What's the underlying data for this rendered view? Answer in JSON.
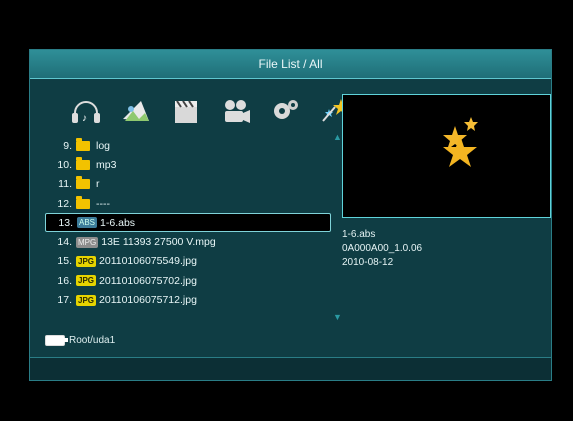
{
  "window": {
    "title": "File List / All"
  },
  "categories": [
    {
      "icon": "music-icon"
    },
    {
      "icon": "picture-icon"
    },
    {
      "icon": "movie-icon"
    },
    {
      "icon": "camera-icon"
    },
    {
      "icon": "gear-icon"
    },
    {
      "icon": "star-icon"
    }
  ],
  "files": [
    {
      "num": "9.",
      "badge": "folder",
      "name": "log"
    },
    {
      "num": "10.",
      "badge": "folder",
      "name": "mp3"
    },
    {
      "num": "11.",
      "badge": "folder",
      "name": "r"
    },
    {
      "num": "12.",
      "badge": "folder",
      "name": "----"
    },
    {
      "num": "13.",
      "badge": "ABS",
      "name": "1-6.abs"
    },
    {
      "num": "14.",
      "badge": "MPG",
      "name": "13E 11393 27500 V.mpg"
    },
    {
      "num": "15.",
      "badge": "JPG",
      "name": "20110106075549.jpg"
    },
    {
      "num": "16.",
      "badge": "JPG",
      "name": "20110106075702.jpg"
    },
    {
      "num": "17.",
      "badge": "JPG",
      "name": "20110106075712.jpg"
    }
  ],
  "selected_index": 4,
  "info": {
    "line1": "1-6.abs",
    "line2": "0A000A00_1.0.06",
    "line3": "2010-08-12"
  },
  "path": {
    "text": "Root/uda1"
  },
  "colors": {
    "accent": "#5fd3da",
    "panel": "#0f3d44",
    "folder": "#f2c200",
    "jpg": "#e7d400"
  }
}
